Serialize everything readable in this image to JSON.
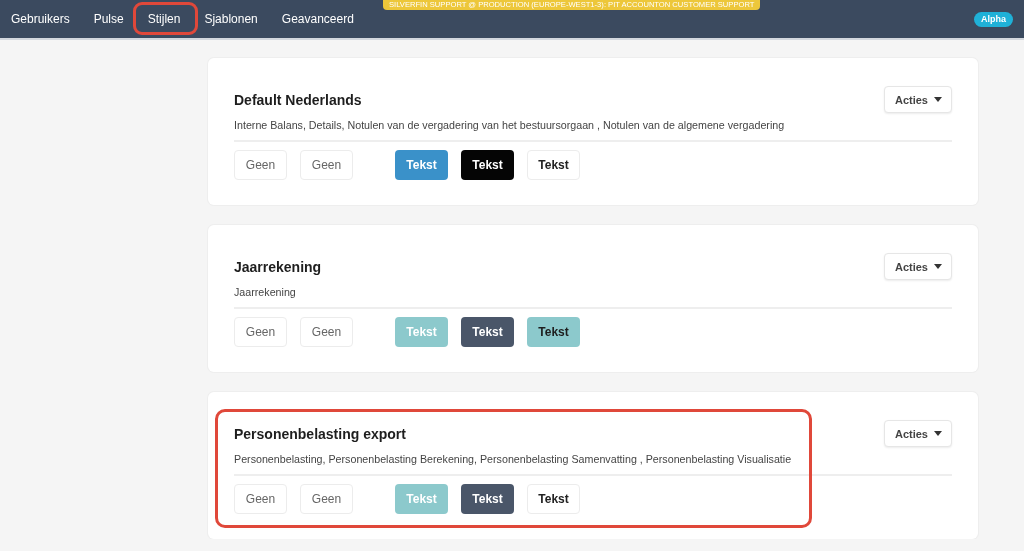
{
  "navigation": {
    "items": [
      {
        "label": "Gebruikers",
        "annotated": false
      },
      {
        "label": "Pulse",
        "annotated": false
      },
      {
        "label": "Stijlen",
        "annotated": true
      },
      {
        "label": "Sjablonen",
        "annotated": false
      },
      {
        "label": "Geavanceerd",
        "annotated": false
      }
    ],
    "banner": "SILVERFIN SUPPORT @ PRODUCTION (EUROPE-WEST1-3): PIT ACCOUNTON CUSTOMER SUPPORT",
    "badge": "Alpha"
  },
  "cards": [
    {
      "title": "Default Nederlands",
      "annotated": false,
      "actions_label": "Acties",
      "description": "Interne Balans, Details, Notulen van de vergadering van het bestuursorgaan , Notulen van de algemene vergadering",
      "button_groups": [
        [
          {
            "label": "Geen",
            "kind": "plain"
          },
          {
            "label": "Geen",
            "kind": "plain"
          }
        ],
        [
          {
            "label": "Tekst",
            "kind": "filled-light-text",
            "color": "#3a91c9"
          },
          {
            "label": "Tekst",
            "kind": "filled-light-text",
            "color": "#050505"
          },
          {
            "label": "Tekst",
            "kind": "outline"
          }
        ]
      ]
    },
    {
      "title": "Jaarrekening",
      "annotated": false,
      "actions_label": "Acties",
      "description": "Jaarrekening",
      "button_groups": [
        [
          {
            "label": "Geen",
            "kind": "plain"
          },
          {
            "label": "Geen",
            "kind": "plain"
          }
        ],
        [
          {
            "label": "Tekst",
            "kind": "filled-light-text",
            "color": "#8cc9cc"
          },
          {
            "label": "Tekst",
            "kind": "filled-light-text",
            "color": "#4a5669"
          },
          {
            "label": "Tekst",
            "kind": "filled-dark-text",
            "color": "#8cc9cc"
          }
        ]
      ]
    },
    {
      "title": "Personenbelasting export",
      "annotated": true,
      "actions_label": "Acties",
      "description": "Personenbelasting, Personenbelasting Berekening, Personenbelasting Samenvatting , Personenbelasting Visualisatie",
      "button_groups": [
        [
          {
            "label": "Geen",
            "kind": "plain"
          },
          {
            "label": "Geen",
            "kind": "plain"
          }
        ],
        [
          {
            "label": "Tekst",
            "kind": "filled-light-text",
            "color": "#8cc9cc"
          },
          {
            "label": "Tekst",
            "kind": "filled-light-text",
            "color": "#4a5669"
          },
          {
            "label": "Tekst",
            "kind": "outline"
          }
        ]
      ]
    }
  ]
}
